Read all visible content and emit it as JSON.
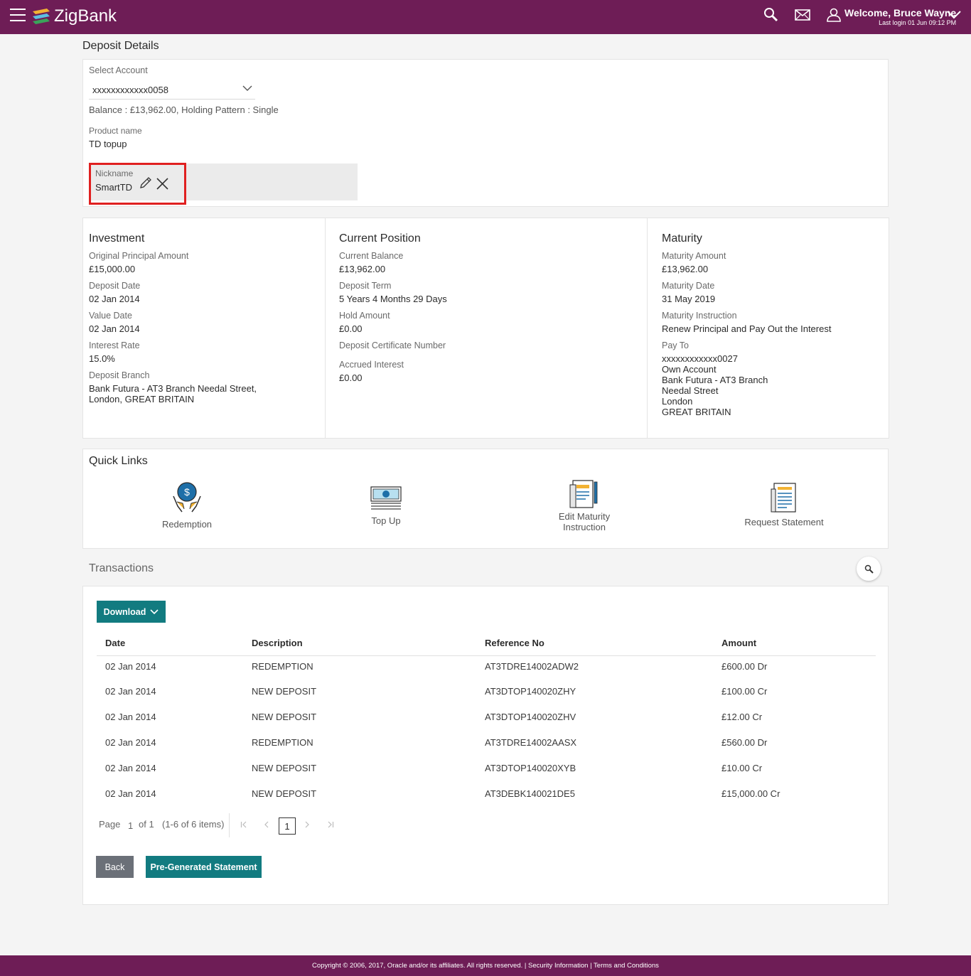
{
  "header": {
    "brand": "ZigBank",
    "welcome": "Welcome, Bruce Wayne",
    "last_login": "Last login 01 Jun 09:12 PM"
  },
  "page_title": "Deposit Details",
  "account": {
    "select_label": "Select Account",
    "selected": "xxxxxxxxxxxx0058",
    "balance_line": "Balance : £13,962.00, Holding Pattern : Single",
    "product_label": "Product name",
    "product_value": "TD topup",
    "nickname_label": "Nickname",
    "nickname_value": "SmartTD"
  },
  "investment": {
    "title": "Investment",
    "principal_label": "Original Principal Amount",
    "principal_value": "£15,000.00",
    "deposit_date_label": "Deposit Date",
    "deposit_date_value": "02 Jan 2014",
    "value_date_label": "Value Date",
    "value_date_value": "02 Jan 2014",
    "rate_label": "Interest Rate",
    "rate_value": "15.0%",
    "branch_label": "Deposit Branch",
    "branch_line1": "Bank Futura - AT3 Branch Needal Street,",
    "branch_line2": "London, GREAT BRITAIN"
  },
  "position": {
    "title": "Current Position",
    "balance_label": "Current Balance",
    "balance_value": "£13,962.00",
    "term_label": "Deposit Term",
    "term_value": "5 Years 4 Months 29 Days",
    "hold_label": "Hold Amount",
    "hold_value": "£0.00",
    "cert_label": "Deposit Certificate Number",
    "accrued_label": "Accrued Interest",
    "accrued_value": "£0.00"
  },
  "maturity": {
    "title": "Maturity",
    "amount_label": "Maturity Amount",
    "amount_value": "£13,962.00",
    "date_label": "Maturity Date",
    "date_value": "31 May 2019",
    "instruction_label": "Maturity Instruction",
    "instruction_value": "Renew Principal and Pay Out the Interest",
    "payto_label": "Pay To",
    "payto_lines": [
      "xxxxxxxxxxxx0027",
      "Own Account",
      "Bank Futura - AT3 Branch",
      "Needal Street",
      "London",
      "GREAT BRITAIN"
    ]
  },
  "quick_links": {
    "title": "Quick Links",
    "items": [
      "Redemption",
      "Top Up",
      "Edit Maturity",
      "Instruction",
      "Request Statement"
    ]
  },
  "transactions": {
    "title": "Transactions",
    "download_label": "Download",
    "columns": [
      "Date",
      "Description",
      "Reference No",
      "Amount"
    ],
    "rows": [
      [
        "02 Jan 2014",
        "REDEMPTION",
        "AT3TDRE14002ADW2",
        "£600.00 Dr"
      ],
      [
        "02 Jan 2014",
        "NEW DEPOSIT",
        "AT3DTOP140020ZHY",
        "£100.00 Cr"
      ],
      [
        "02 Jan 2014",
        "NEW DEPOSIT",
        "AT3DTOP140020ZHV",
        "£12.00 Cr"
      ],
      [
        "02 Jan 2014",
        "REDEMPTION",
        "AT3TDRE14002AASX",
        "£560.00 Dr"
      ],
      [
        "02 Jan 2014",
        "NEW DEPOSIT",
        "AT3DTOP140020XYB",
        "£10.00 Cr"
      ],
      [
        "02 Jan 2014",
        "NEW DEPOSIT",
        "AT3DEBK140021DE5",
        "£15,000.00 Cr"
      ]
    ],
    "pager": {
      "page_label": "Page",
      "page_value": "1",
      "of_label": "of 1",
      "items_label": "(1-6 of 6 items)",
      "current": "1"
    }
  },
  "actions": {
    "back": "Back",
    "pregenerated": "Pre-Generated Statement"
  },
  "footer": "Copyright © 2006, 2017, Oracle and/or its affiliates. All rights reserved. | Security Information | Terms and Conditions",
  "colors": {
    "brand": "#6e1d56",
    "accent": "#127b80",
    "highlight": "#e02020"
  }
}
